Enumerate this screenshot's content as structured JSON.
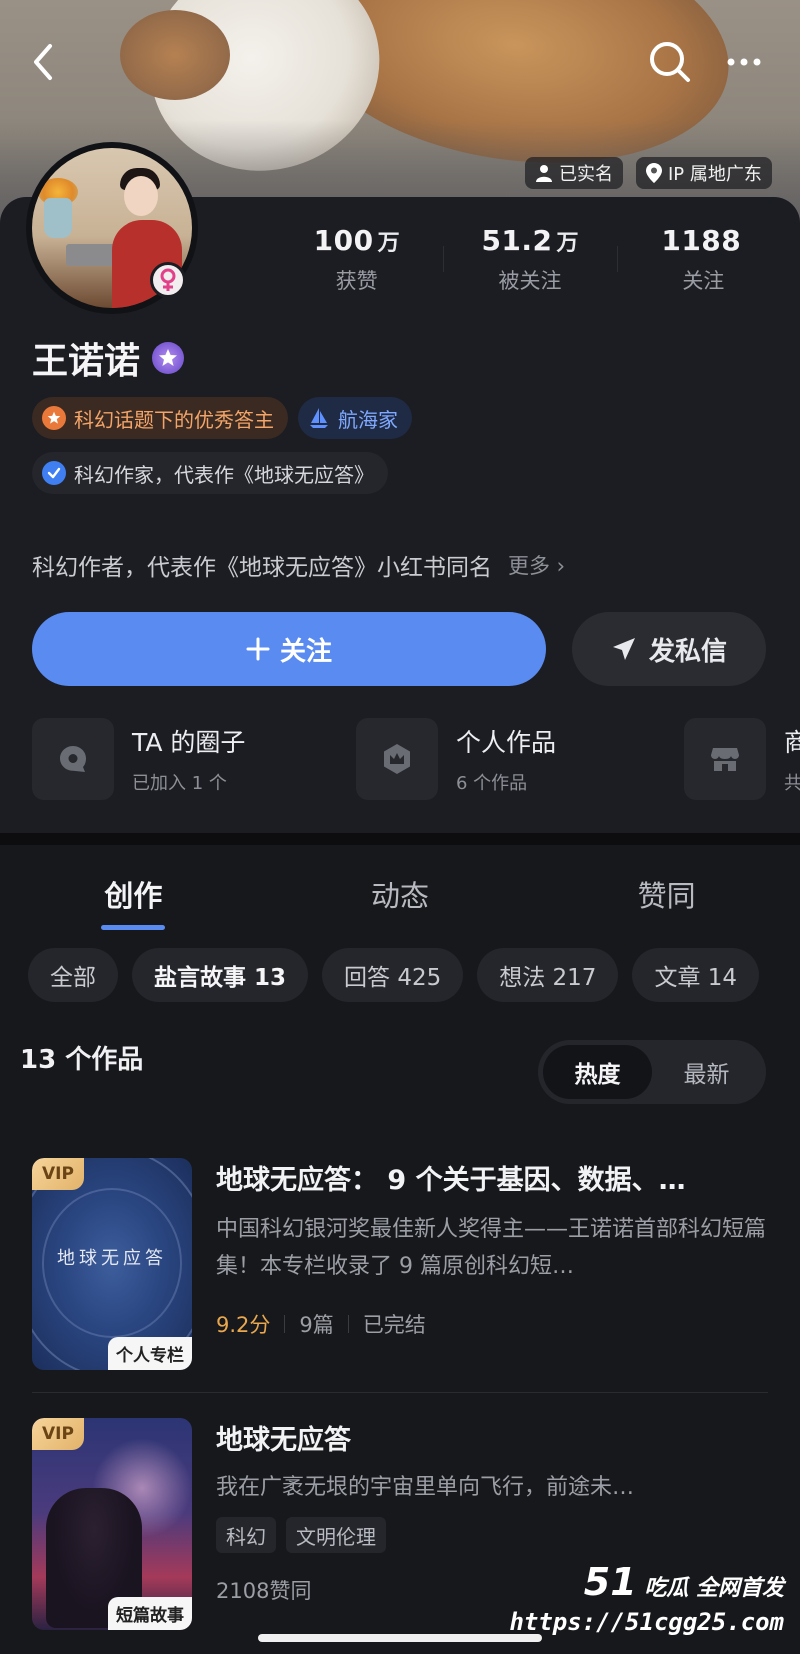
{
  "header": {
    "verified_label": "已实名",
    "ip_label": "IP 属地广东"
  },
  "stats": [
    {
      "num": "100",
      "unit": "万",
      "label": "获赞"
    },
    {
      "num": "51.2",
      "unit": "万",
      "label": "被关注"
    },
    {
      "num": "1188",
      "unit": "",
      "label": "关注"
    }
  ],
  "profile": {
    "name": "王诺诺",
    "badges": [
      "科幻话题下的优秀答主",
      "航海家"
    ],
    "identity": "科幻作家，代表作《地球无应答》",
    "bio": "科幻作者，代表作《地球无应答》小红书同名",
    "bio_more": "更多 ›"
  },
  "actions": {
    "follow": "关注",
    "message": "发私信"
  },
  "quick_links": [
    {
      "title": "TA 的圈子",
      "sub": "已加入 1 个"
    },
    {
      "title": "个人作品",
      "sub": "6 个作品"
    },
    {
      "title": "商",
      "sub": "共"
    }
  ],
  "tabs": [
    "创作",
    "动态",
    "赞同"
  ],
  "chips": [
    "全部",
    "盐言故事 13",
    "回答 425",
    "想法 217",
    "文章 14"
  ],
  "works_count": "13 个作品",
  "sort": [
    "热度",
    "最新"
  ],
  "items": [
    {
      "vip": "VIP",
      "cover_text": "地球无应答",
      "cover_label": "个人专栏",
      "title": "地球无应答： 9 个关于基因、数据、…",
      "desc": "中国科幻银河奖最佳新人奖得主——王诺诺首部科幻短篇集！本专栏收录了 9 篇原创科幻短…",
      "score": "9.2分",
      "count": "9篇",
      "status": "已完结"
    },
    {
      "vip": "VIP",
      "cover_label": "短篇故事",
      "title": "地球无应答",
      "desc": "我在广袤无垠的宇宙里单向飞行，前途未…",
      "tags": [
        "科幻",
        "文明伦理"
      ],
      "likes": "2108赞同"
    }
  ],
  "watermark": {
    "brand_num": "51",
    "brand_text": "吃瓜 全网首发",
    "url": "https://51cgg25.com"
  }
}
